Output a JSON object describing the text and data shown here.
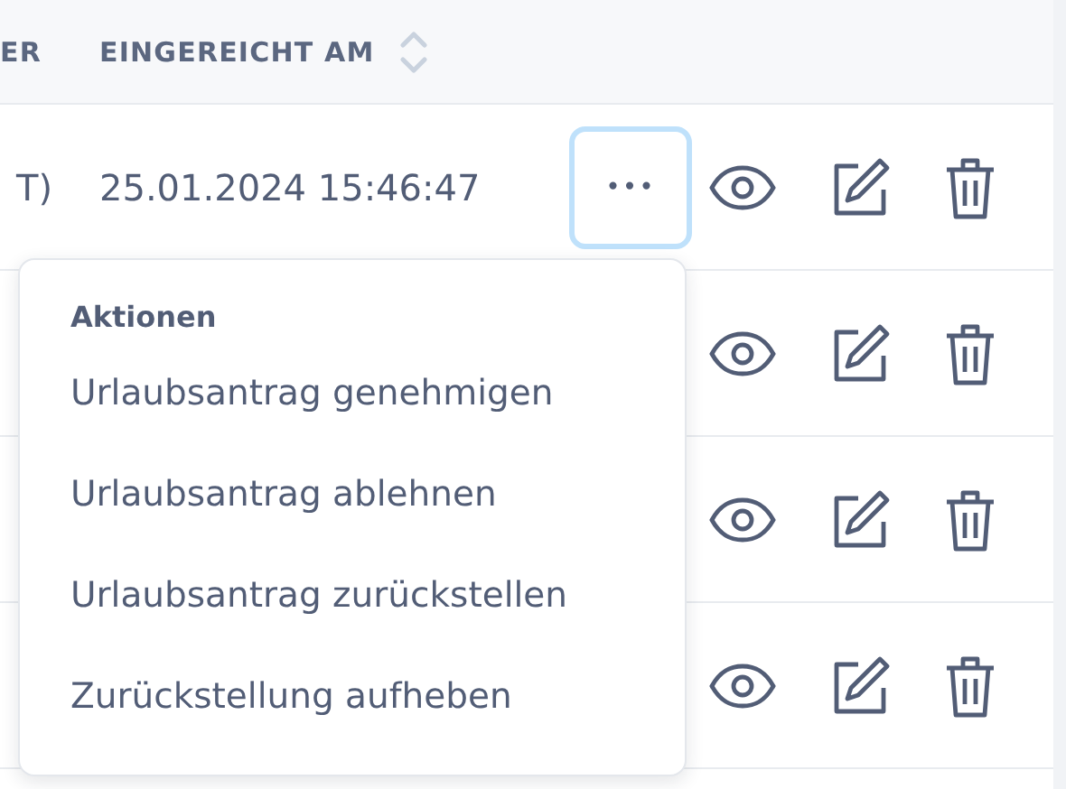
{
  "table": {
    "columns": [
      {
        "label": "ER"
      },
      {
        "label": "EINGEREICHT AM",
        "sortable": true
      }
    ],
    "rows": [
      {
        "column_1": "T)",
        "submitted_at": "25.01.2024 15:46:47",
        "actions_button": {
          "label": "•••",
          "focused": true
        }
      },
      {},
      {},
      {}
    ]
  },
  "actions_menu": {
    "header": "Aktionen",
    "items": [
      "Urlaubsantrag genehmigen",
      "Urlaubsantrag ablehnen",
      "Urlaubsantrag zurückstellen",
      "Zurückstellung aufheben"
    ]
  }
}
